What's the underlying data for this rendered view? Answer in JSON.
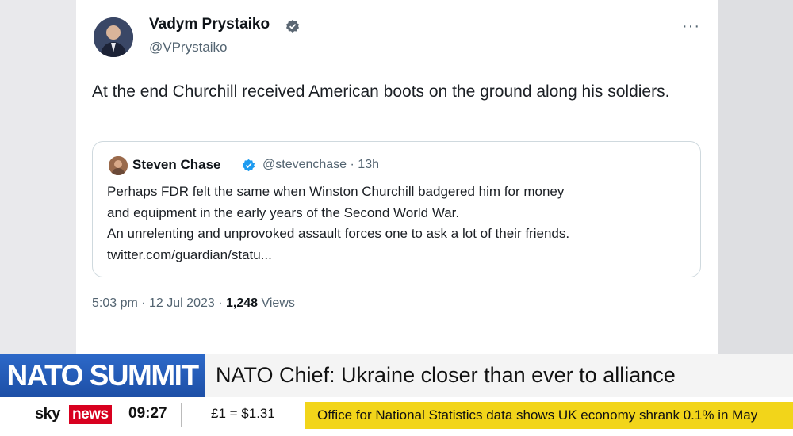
{
  "tweet": {
    "author_name": "Vadym Prystaiko",
    "author_handle": "@VPrystaiko",
    "text": "At the end Churchill received American boots on the ground along his soldiers.",
    "timestamp": "5:03 pm · 12 Jul 2023 · ",
    "views_count": "1,248",
    "views_label": " Views",
    "more_icon": "more-horizontal-icon"
  },
  "quote": {
    "author_name": "Steven Chase",
    "meta": "@stevenchase · 13h",
    "lines": [
      "Perhaps FDR felt the same when Winston Churchill badgered him for money",
      "and equipment in the early years of the Second World War.",
      "An unrelenting and unprovoked assault forces one to ask a lot of their friends.",
      "twitter.com/guardian/statu..."
    ]
  },
  "lower_third": {
    "section": "NATO SUMMIT",
    "headline": "NATO Chief: Ukraine closer than ever to alliance"
  },
  "ticker": {
    "logo_sky": "sky",
    "logo_news": "news",
    "time": "09:27",
    "fx": "£1 = $1.31",
    "news": "Office for National Statistics data shows UK economy shrank 0.1% in May"
  },
  "colors": {
    "verified": "#1d9bf0",
    "section_bg": "#2360bd",
    "ticker_bg": "#f2d51a",
    "news_red": "#d8001f"
  }
}
